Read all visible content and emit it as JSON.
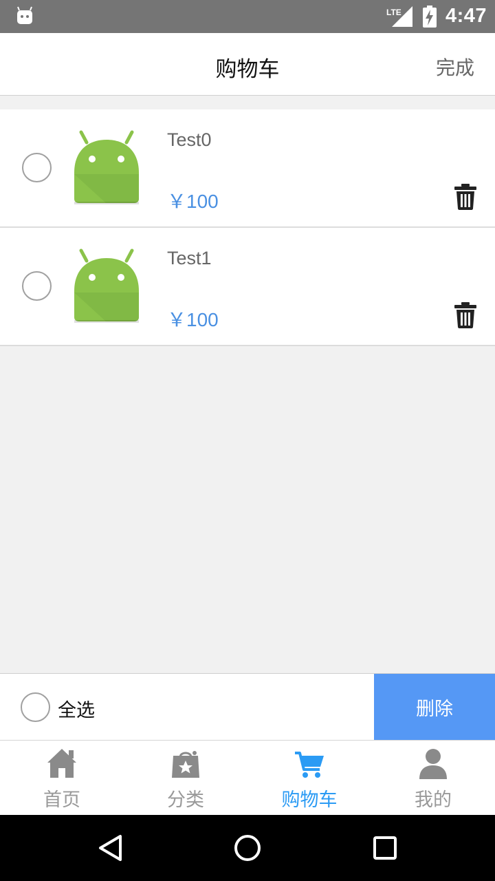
{
  "status_bar": {
    "time": "4:47",
    "network": "LTE",
    "icons": [
      "android-robot-icon",
      "signal-icon",
      "battery-charging-icon"
    ]
  },
  "header": {
    "title": "购物车",
    "done_label": "完成"
  },
  "cart": {
    "items": [
      {
        "name": "Test0",
        "price": "￥100",
        "selected": false,
        "image_icon": "android-logo-icon"
      },
      {
        "name": "Test1",
        "price": "￥100",
        "selected": false,
        "image_icon": "android-logo-icon"
      }
    ]
  },
  "action_bar": {
    "select_all_label": "全选",
    "delete_label": "删除"
  },
  "tabs": [
    {
      "label": "首页",
      "icon": "home-icon",
      "active": false
    },
    {
      "label": "分类",
      "icon": "category-bag-icon",
      "active": false
    },
    {
      "label": "购物车",
      "icon": "cart-icon",
      "active": true
    },
    {
      "label": "我的",
      "icon": "person-icon",
      "active": false
    }
  ],
  "colors": {
    "accent": "#2b9bf4",
    "price": "#4a90e2",
    "delete_button": "#5598f5",
    "status_bar": "#757575",
    "inactive_tab": "#999999"
  }
}
